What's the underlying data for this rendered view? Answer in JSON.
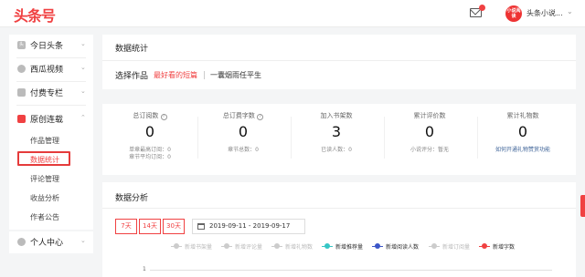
{
  "header": {
    "logo": "头条号",
    "account_name": "头条小说...",
    "avatar_text": "小说阅读",
    "brand_color": "#f04142"
  },
  "sidebar": {
    "items": [
      {
        "label": "今日头条",
        "icon": "toutiao-icon"
      },
      {
        "label": "西瓜视频",
        "icon": "xigua-icon"
      },
      {
        "label": "付费专栏",
        "icon": "column-icon"
      },
      {
        "label": "原创连载",
        "icon": "book-icon"
      }
    ],
    "subitems": [
      "作品管理",
      "数据统计",
      "评论管理",
      "收益分析",
      "作者公告"
    ],
    "personal": "个人中心"
  },
  "stats_panel": {
    "title": "数据统计",
    "select_label": "选择作品",
    "works": [
      "最好看的短篇",
      "一囊烟雨任平生"
    ]
  },
  "stats": [
    {
      "label": "总订阅数",
      "value": "0",
      "sub": [
        "单章最高订阅：0",
        "章节平均订阅：0"
      ]
    },
    {
      "label": "总订费字数",
      "value": "0",
      "sub": [
        "章节总数：0"
      ]
    },
    {
      "label": "加入书架数",
      "value": "3",
      "sub": [
        "已读人数：0"
      ]
    },
    {
      "label": "累计评价数",
      "value": "0",
      "sub": [
        "小说评分：暂无"
      ]
    },
    {
      "label": "累计礼物数",
      "value": "0",
      "sub": [
        "如何开通礼物赞赏功能"
      ]
    }
  ],
  "analysis": {
    "title": "数据分析",
    "ranges": [
      "7天",
      "14天",
      "30天"
    ],
    "date_range": "2019-09-11 - 2019-09-17",
    "legend": [
      {
        "label": "新增书架量",
        "active": false,
        "color": "#cccccc"
      },
      {
        "label": "新增评论量",
        "active": false,
        "color": "#cccccc"
      },
      {
        "label": "新增礼物数",
        "active": false,
        "color": "#cccccc"
      },
      {
        "label": "新增推荐量",
        "active": true,
        "color": "#36c6c5"
      },
      {
        "label": "新增阅读人数",
        "active": true,
        "color": "#3c56c8"
      },
      {
        "label": "新增订阅量",
        "active": false,
        "color": "#cccccc"
      },
      {
        "label": "新增字数",
        "active": true,
        "color": "#f04142"
      }
    ],
    "y_tick": "1"
  }
}
